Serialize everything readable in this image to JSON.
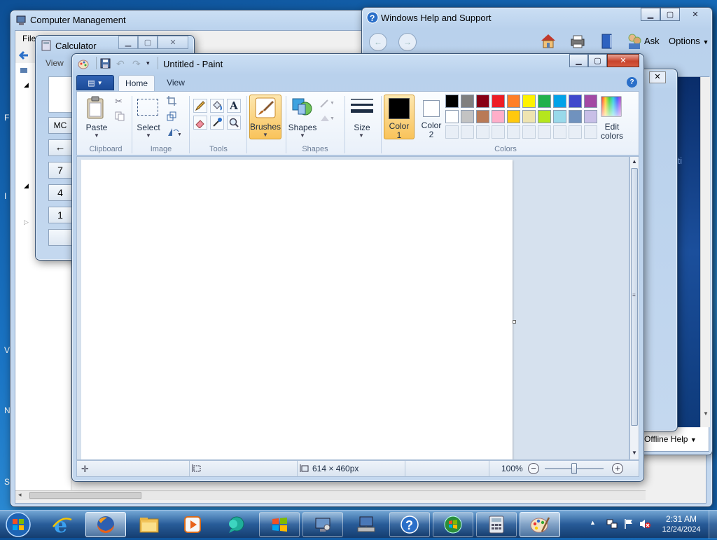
{
  "desktop": {
    "edge_letters": [
      "F",
      "I",
      "V",
      "N",
      "S"
    ]
  },
  "computer_management": {
    "title": "Computer Management",
    "menu_file": "File"
  },
  "calculator": {
    "title": "Calculator",
    "menu_view": "View",
    "keys": [
      "MC",
      "←",
      "7",
      "4",
      "1"
    ]
  },
  "help": {
    "title": "Windows Help and Support",
    "ask": "Ask",
    "options": "Options",
    "offline_help": "Offline Help",
    "partial_text": "arti"
  },
  "paint": {
    "title": "Untitled - Paint",
    "tabs": [
      "Home",
      "View"
    ],
    "groups": {
      "clipboard": "Clipboard",
      "image": "Image",
      "tools": "Tools",
      "shapes": "Shapes",
      "colors": "Colors"
    },
    "buttons": {
      "paste": "Paste",
      "select": "Select",
      "brushes": "Brushes",
      "shapes": "Shapes",
      "size": "Size",
      "color1_a": "Color",
      "color1_b": "1",
      "color2_a": "Color",
      "color2_b": "2",
      "edit_colors_a": "Edit",
      "edit_colors_b": "colors"
    },
    "palette_row1": [
      "#000000",
      "#7f7f7f",
      "#880015",
      "#ed1c24",
      "#ff7f27",
      "#fff200",
      "#22b14c",
      "#00a2e8",
      "#3f48cc",
      "#a349a4"
    ],
    "palette_row2": [
      "#ffffff",
      "#c3c3c3",
      "#b97a57",
      "#ffaec9",
      "#ffc90e",
      "#efe4b0",
      "#b5e61d",
      "#99d9ea",
      "#7092be",
      "#c8bfe7"
    ],
    "color1": "#000000",
    "color2": "#ffffff",
    "status": {
      "dimensions": "614 × 460px",
      "zoom": "100%",
      "zoom_level": 0.5
    }
  },
  "taskbar": {
    "time": "2:31 AM",
    "date": "12/24/2024"
  }
}
